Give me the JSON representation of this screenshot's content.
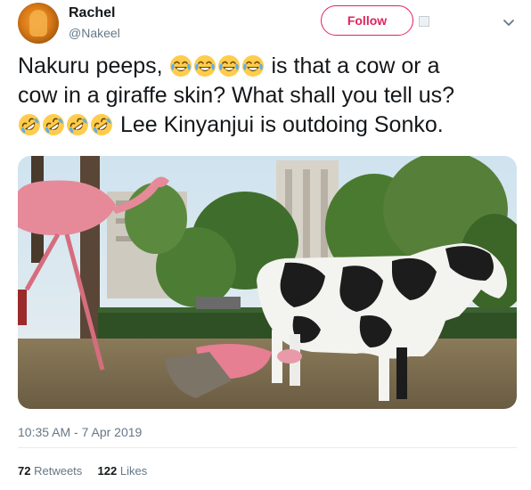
{
  "user": {
    "name": "Rachel",
    "handle": "@Nakeel"
  },
  "follow_label": "Follow",
  "tweet": {
    "line1_pre": "Nakuru peeps, ",
    "line1_post": " is that a cow or a",
    "line2": "cow in a giraffe skin? What shall you tell us?",
    "line3_post": " Lee Kinyanjui is outdoing Sonko.",
    "emoji_joy": "face-with-tears-of-joy-icon",
    "emoji_rofl": "rolling-on-the-floor-laughing-icon"
  },
  "timestamp": "10:35 AM - 7 Apr 2019",
  "stats": {
    "retweets_count": "72",
    "retweets_label": "Retweets",
    "likes_count": "122",
    "likes_label": "Likes"
  },
  "colors": {
    "follow": "#e0245e",
    "secondary_text": "#657786",
    "primary_text": "#14171a"
  },
  "media": {
    "subject": "photo-cow-and-flamingo-statues"
  }
}
